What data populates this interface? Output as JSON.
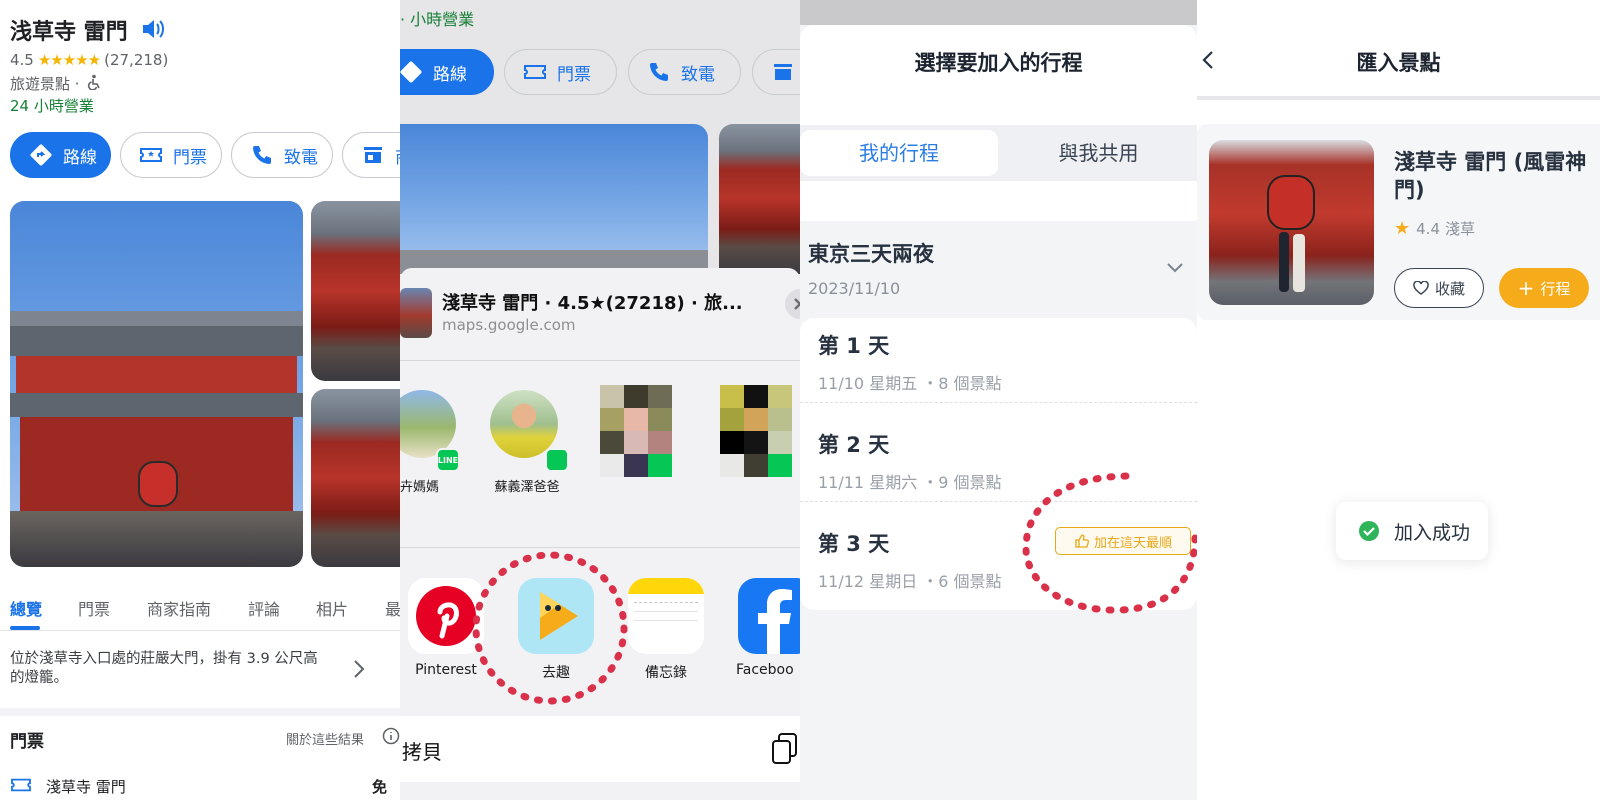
{
  "panel1": {
    "place_title": "浅草寺 雷門",
    "rating": "4.5",
    "stars": "★★★★★",
    "review_count": "(27,218)",
    "category": "旅遊景點 ·",
    "hours": "24 小時營業",
    "actions": [
      "路線",
      "門票",
      "致電",
      "商"
    ],
    "tabs": [
      "總覽",
      "門票",
      "商家指南",
      "評論",
      "相片",
      "最"
    ],
    "description": "位於淺草寺入口處的莊嚴大門，掛有 3.9 公尺高的燈籠。",
    "tickets_heading": "門票",
    "about_results": "關於這些結果",
    "ticket_item": "淺草寺 雷門",
    "ticket_price": "免費"
  },
  "panel2": {
    "hours_partial": "小時營業",
    "actions": [
      "路線",
      "門票",
      "致電"
    ],
    "share_title": "淺草寺 雷門 · 4.5★(27218) · 旅...",
    "share_url": "maps.google.com",
    "contacts": [
      "卉媽媽",
      "蘇義澤爸爸"
    ],
    "apps": [
      "Pinterest",
      "去趣",
      "備忘錄",
      "Faceboo"
    ],
    "copy_label": "拷貝"
  },
  "panel3": {
    "title": "選擇要加入的行程",
    "tab_mine": "我的行程",
    "tab_shared": "與我共用",
    "trip_name": "東京三天兩夜",
    "trip_date": "2023/11/10",
    "days": [
      {
        "title": "第 1 天",
        "sub": "11/10 星期五 ・8 個景點"
      },
      {
        "title": "第 2 天",
        "sub": "11/11 星期六 ・9 個景點"
      },
      {
        "title": "第 3 天",
        "sub": "11/12 星期日 ・6 個景點"
      }
    ],
    "best_badge": "加在這天最順"
  },
  "panel4": {
    "title": "匯入景點",
    "spot_name": "淺草寺 雷門 (風雷神門)",
    "rating": "4.4",
    "area": "淺草",
    "save_label": "收藏",
    "trip_label": "行程",
    "toast": "加入成功"
  },
  "colors": {
    "google_blue": "#1a73e8",
    "open_green": "#188038",
    "star_yellow": "#f4b400",
    "active_tab_blue": "#2b7de3",
    "badge_orange": "#e6a817",
    "trip_button_orange": "#f6ac1a",
    "annotation_red": "#d9314a",
    "success_green": "#2fb45a"
  }
}
